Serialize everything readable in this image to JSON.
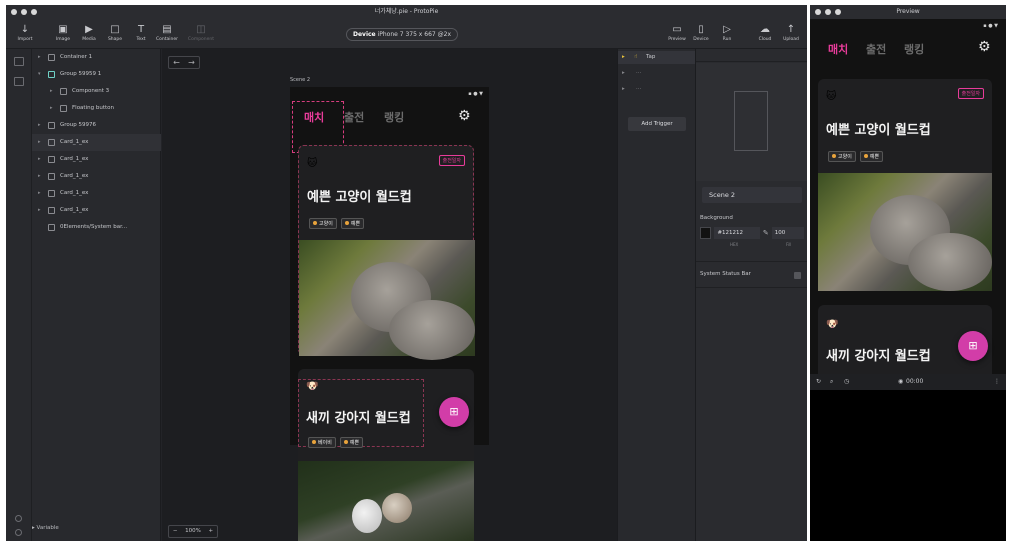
{
  "app": {
    "window_title": "너가체냥.pie - ProtoPie"
  },
  "toolbar": {
    "tools": [
      {
        "label": "Import",
        "icon": "↓"
      },
      {
        "label": "Image",
        "icon": "▣"
      },
      {
        "label": "Media",
        "icon": "▶"
      },
      {
        "label": "Shape",
        "icon": "□"
      },
      {
        "label": "Text",
        "icon": "T"
      },
      {
        "label": "Container",
        "icon": "▤"
      },
      {
        "label": "Component",
        "icon": "◫"
      }
    ],
    "device_prefix": "Device",
    "device_value": "iPhone 7  375 x 667  @2x",
    "right_tools": [
      {
        "label": "Preview",
        "icon": "▭"
      },
      {
        "label": "Device",
        "icon": "▯"
      },
      {
        "label": "Run",
        "icon": "▷"
      },
      {
        "label": "Cloud",
        "icon": "☁"
      },
      {
        "label": "Upload",
        "icon": "↑"
      }
    ]
  },
  "layers": [
    {
      "name": "Container 1",
      "indent": 0
    },
    {
      "name": "Group 59959 1",
      "indent": 0
    },
    {
      "name": "Component 3",
      "indent": 1
    },
    {
      "name": "Floating button",
      "indent": 1
    },
    {
      "name": "Group 59976",
      "indent": 0
    },
    {
      "name": "Card_1_ex",
      "indent": 0
    },
    {
      "name": "Card_1_ex",
      "indent": 0
    },
    {
      "name": "Card_1_ex",
      "indent": 0
    },
    {
      "name": "Card_1_ex",
      "indent": 0
    },
    {
      "name": "Card_1_ex",
      "indent": 0
    },
    {
      "name": "0Elements/System bar...",
      "indent": 0
    }
  ],
  "variable_label": "Variable",
  "canvas": {
    "scene_label": "Scene 2",
    "zoom_minus": "−",
    "zoom_value": "100%",
    "zoom_plus": "+",
    "nav_back": "←",
    "nav_forward": "→"
  },
  "phone": {
    "status": "▪ ● ▼",
    "tabs": [
      "매치",
      "출전",
      "랭킹"
    ],
    "active_tab": "매치",
    "card1": {
      "emoji": "🐱",
      "badge": "출전일자",
      "title": "예쁜 고양이 월드컵",
      "tags": [
        "고양이",
        "예쁜"
      ]
    },
    "card2": {
      "emoji": "🐶",
      "title": "새끼 강아지 월드컵",
      "tags": [
        "베이비",
        "예쁜"
      ]
    },
    "fab_icon": "⊞"
  },
  "triggers": {
    "items": [
      "Tap",
      "",
      ""
    ],
    "add_label": "Add Trigger"
  },
  "props": {
    "scene_name": "Scene 2",
    "background_label": "Background",
    "hex_value": "#121212",
    "opacity_value": "100",
    "hex_caption": "HEX",
    "fill_caption": "Fill",
    "status_bar_label": "System Status Bar"
  },
  "preview": {
    "title": "Preview",
    "controls": {
      "time": "00:00"
    }
  },
  "colors": {
    "accent": "#e83c9a",
    "fab": "#d23da8",
    "bg": "#121212"
  }
}
